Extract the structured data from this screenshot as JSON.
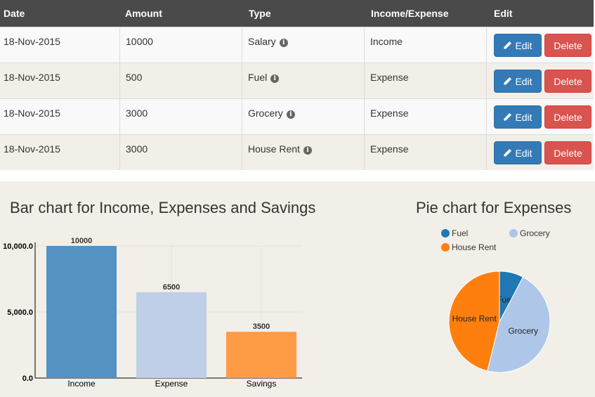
{
  "table": {
    "headers": [
      "Date",
      "Amount",
      "Type",
      "Income/Expense",
      "Edit"
    ],
    "rows": [
      {
        "date": "18-Nov-2015",
        "amount": "10000",
        "type": "Salary",
        "kind": "Income"
      },
      {
        "date": "18-Nov-2015",
        "amount": "500",
        "type": "Fuel",
        "kind": "Expense"
      },
      {
        "date": "18-Nov-2015",
        "amount": "3000",
        "type": "Grocery",
        "kind": "Expense"
      },
      {
        "date": "18-Nov-2015",
        "amount": "3000",
        "type": "House Rent",
        "kind": "Expense"
      }
    ],
    "edit_label": "Edit",
    "delete_label": "Delete",
    "info_icon": "info-circle-icon",
    "edit_icon": "pencil-icon",
    "colors": {
      "header_bg": "#4a4a4a",
      "edit_btn": "#337ab7",
      "delete_btn": "#d9534f"
    }
  },
  "chart_data": [
    {
      "type": "bar",
      "title": "Bar chart for Income, Expenses and Savings",
      "categories": [
        "Income",
        "Expense",
        "Savings"
      ],
      "values": [
        10000,
        6500,
        3500
      ],
      "value_labels": [
        "10000",
        "6500",
        "3500"
      ],
      "colors": [
        "#5492c4",
        "#bfcfe8",
        "#ff9a45"
      ],
      "ylim": [
        0,
        10000
      ],
      "yticks": [
        0,
        5000,
        10000
      ],
      "ytick_labels": [
        "0.0",
        "5,000.0",
        "10,000.0"
      ],
      "xlabel": "",
      "ylabel": "",
      "grid": true
    },
    {
      "type": "pie",
      "title": "Pie chart for Expenses",
      "labels": [
        "Fuel",
        "Grocery",
        "House Rent"
      ],
      "values": [
        500,
        3000,
        3000
      ],
      "colors": [
        "#1f77b4",
        "#aec7e8",
        "#ff7f0e"
      ],
      "legend_position": "top"
    }
  ]
}
